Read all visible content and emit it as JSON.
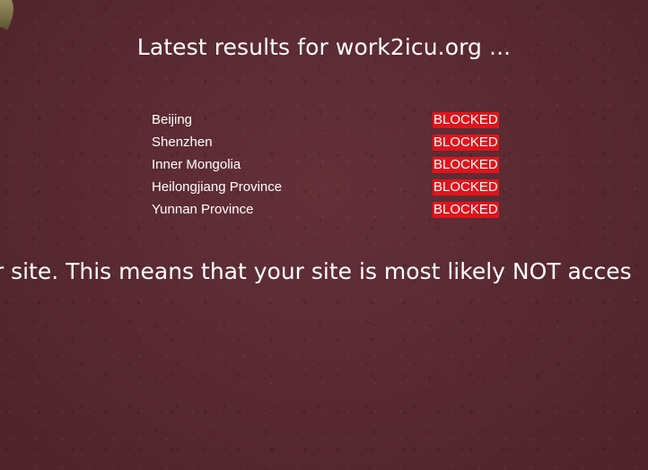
{
  "heading": "Latest results for work2icu.org ...",
  "results": [
    {
      "location": "Beijing",
      "status": "BLOCKED"
    },
    {
      "location": "Shenzhen",
      "status": "BLOCKED"
    },
    {
      "location": "Inner Mongolia",
      "status": "BLOCKED"
    },
    {
      "location": "Heilongjiang Province",
      "status": "BLOCKED"
    },
    {
      "location": "Yunnan Province",
      "status": "BLOCKED"
    }
  ],
  "message": "ur site. This means that your site is most likely NOT acces",
  "colors": {
    "background": "#5a2a30",
    "blocked": "#e0141b",
    "text": "#ffffff"
  }
}
